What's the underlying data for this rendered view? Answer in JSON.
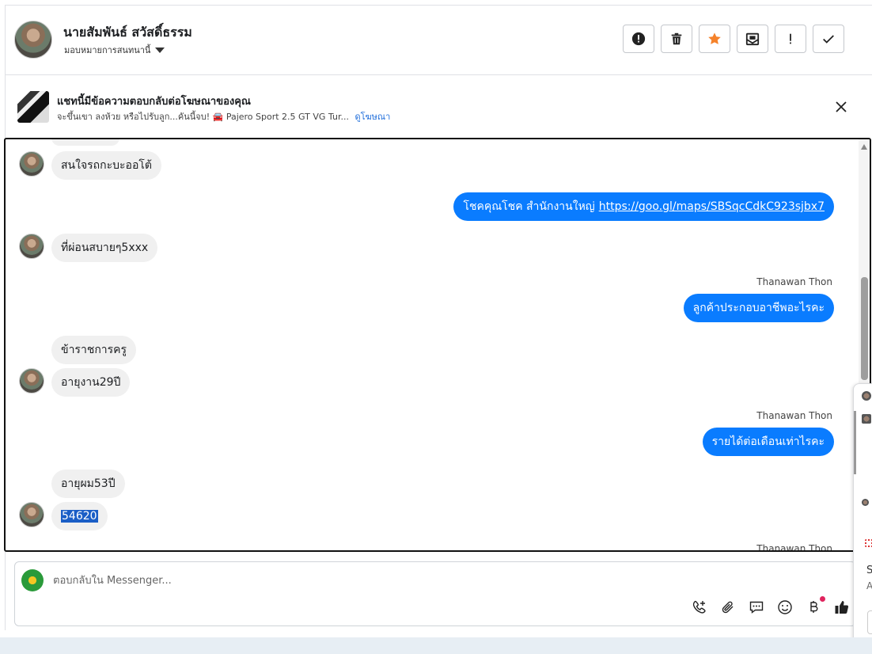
{
  "header": {
    "contact_name": "นายสัมพันธ์ สวัสดิ์ธรรม",
    "assign_label": "มอบหมายการสนทนานี้",
    "actions": [
      {
        "name": "report-button",
        "icon": "alert-circle-icon"
      },
      {
        "name": "delete-button",
        "icon": "trash-icon"
      },
      {
        "name": "star-button",
        "icon": "star-icon",
        "color": "#f5822a"
      },
      {
        "name": "mark-unread-button",
        "icon": "envelope-icon"
      },
      {
        "name": "spam-button",
        "icon": "exclamation-icon"
      },
      {
        "name": "done-button",
        "icon": "check-icon"
      }
    ]
  },
  "ad_banner": {
    "title": "แชทนี้มีข้อความตอบกลับต่อโฆษณาของคุณ",
    "subtitle": "จะขึ้นเขา ลงห้วย หรือไปรับลูก...คันนี้จบ! 🚘 Pajero Sport 2.5 GT VG Tur...",
    "link": "ดูโฆษณา"
  },
  "messages": [
    {
      "id": "m1",
      "side": "in",
      "text": "สนใจรถกะบะออโต้"
    },
    {
      "id": "m2",
      "side": "out",
      "text": "โชคคุณโชค สำนักงานใหญ่",
      "url": "https://goo.gl/maps/SBSqcCdkC923sjbx7"
    },
    {
      "id": "m3",
      "side": "in",
      "text": "ที่ผ่อนสบายๆ5xxx"
    },
    {
      "id": "m4",
      "side": "out",
      "sender": "Thanawan Thon",
      "text": "ลูกค้าประกอบอาชีพอะไรคะ"
    },
    {
      "id": "m5",
      "side": "in",
      "text": "ข้าราชการครู"
    },
    {
      "id": "m6",
      "side": "in",
      "text": "อายุงาน29ปี"
    },
    {
      "id": "m7",
      "side": "out",
      "sender": "Thanawan Thon",
      "text": "รายได้ต่อเดือนเท่าไรคะ"
    },
    {
      "id": "m8",
      "side": "in",
      "text": "อายุผม53ปี"
    },
    {
      "id": "m9",
      "side": "in",
      "text": "54620"
    },
    {
      "id": "m10",
      "side": "out",
      "sender": "Thanawan Thon"
    }
  ],
  "composer": {
    "placeholder": "ตอบกลับใน Messenger...",
    "tools": [
      "call-add-icon",
      "paperclip-icon",
      "chat-bubble-icon",
      "emoji-icon",
      "baht-icon",
      "thumbs-up-icon"
    ]
  },
  "side_panel": {
    "letter_s": "S",
    "letter_a": "A"
  },
  "colors": {
    "outgoing": "#0a7cff",
    "incoming": "#f0f0f0",
    "link": "#216fdb",
    "star": "#f5822a"
  }
}
